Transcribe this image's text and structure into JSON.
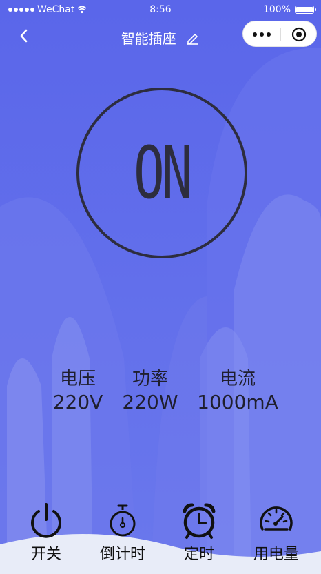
{
  "status_bar": {
    "carrier": "WeChat",
    "time": "8:56",
    "battery": "100%"
  },
  "nav": {
    "title": "智能插座",
    "back_icon": "chevron-left-icon",
    "edit_icon": "pencil-icon",
    "capsule_more_icon": "more-dots-icon",
    "capsule_close_icon": "target-icon"
  },
  "power": {
    "state": "ON"
  },
  "metrics": [
    {
      "label": "电压",
      "value": "220V"
    },
    {
      "label": "功率",
      "value": "220W"
    },
    {
      "label": "电流",
      "value": "1000mA"
    }
  ],
  "bottom_bar": [
    {
      "label": "开关",
      "icon": "power-icon"
    },
    {
      "label": "倒计时",
      "icon": "stopwatch-icon"
    },
    {
      "label": "定时",
      "icon": "alarm-clock-icon"
    },
    {
      "label": "用电量",
      "icon": "gauge-icon"
    }
  ],
  "colors": {
    "background": "#5561e6",
    "foreground_dark": "#2d2d3e"
  }
}
